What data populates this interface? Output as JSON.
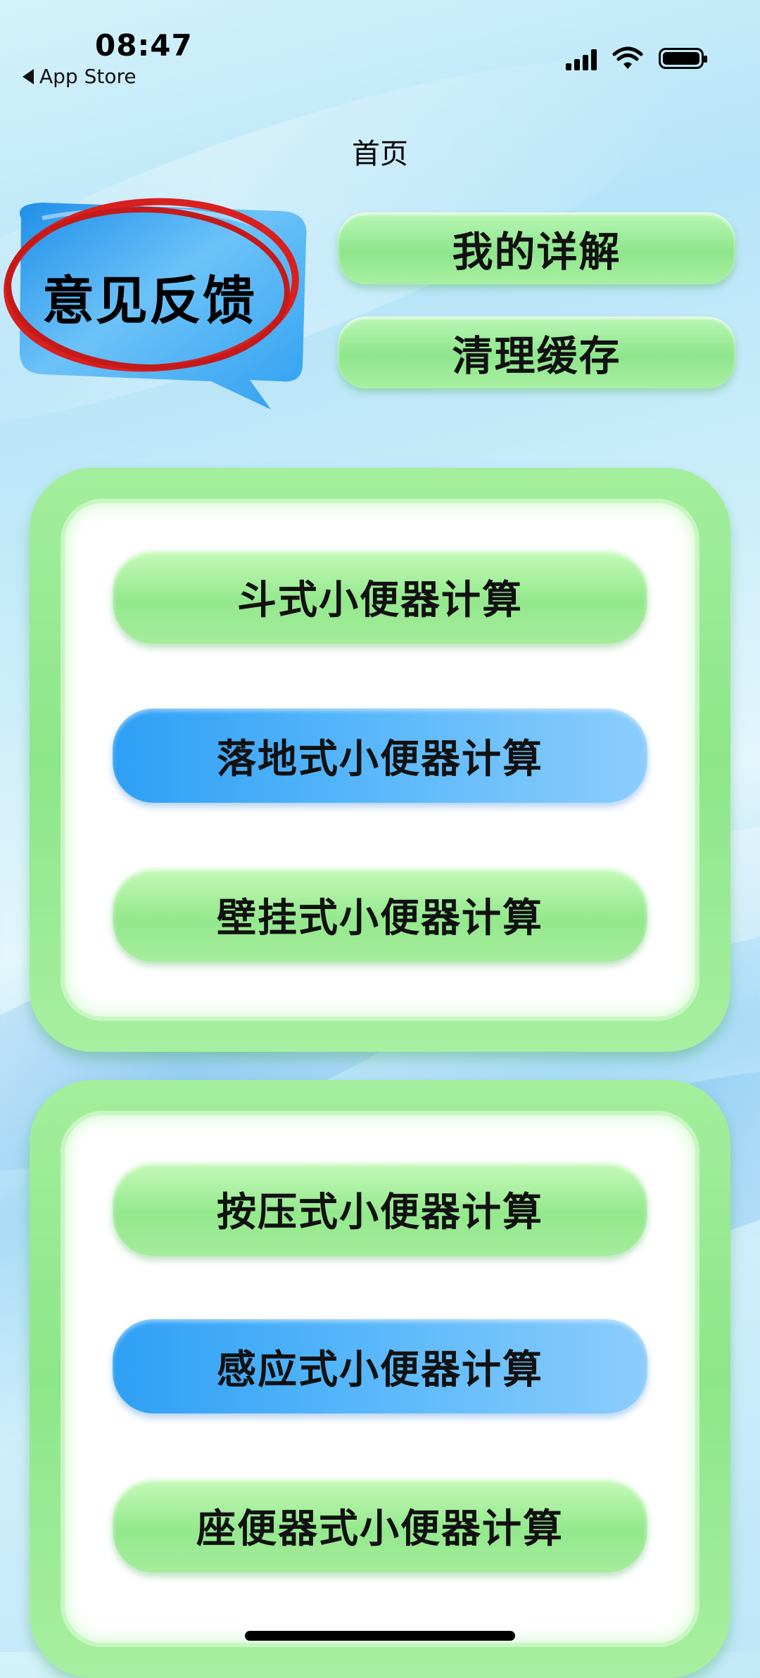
{
  "status_bar": {
    "time": "08:47",
    "back_label": "App Store"
  },
  "nav": {
    "title": "首页"
  },
  "feedback": {
    "label": "意见反馈"
  },
  "top_buttons": {
    "detail": "我的详解",
    "clear_cache": "清理缓存"
  },
  "panel1": {
    "buttons": [
      "斗式小便器计算",
      "落地式小便器计算",
      "壁挂式小便器计算"
    ]
  },
  "panel2": {
    "buttons": [
      "按压式小便器计算",
      "感应式小便器计算",
      "座便器式小便器计算"
    ]
  },
  "colors": {
    "green_button": "#94e88d",
    "blue_button": "#2e9ff5",
    "annotation_red": "#d8201f",
    "bubble_blue": "#3fa8f2"
  }
}
